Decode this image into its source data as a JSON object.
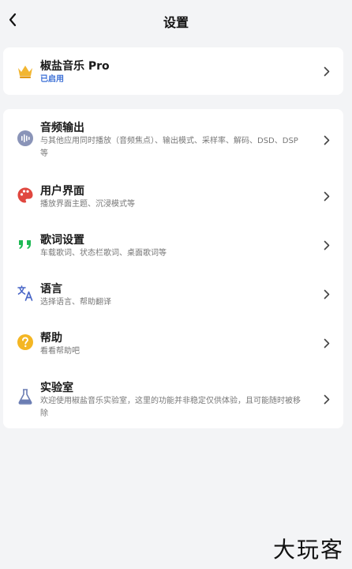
{
  "header": {
    "title": "设置"
  },
  "pro": {
    "title": "椒盐音乐 Pro",
    "status": "已启用"
  },
  "settings": [
    {
      "title": "音频输出",
      "subtitle": "与其他应用同时播放（音频焦点）、输出模式、采样率、解码、DSD、DSP 等",
      "icon": "waveform-icon"
    },
    {
      "title": "用户界面",
      "subtitle": "播放界面主题、沉浸模式等",
      "icon": "palette-icon"
    },
    {
      "title": "歌词设置",
      "subtitle": "车载歌词、状态栏歌词、桌面歌词等",
      "icon": "quote-icon"
    },
    {
      "title": "语言",
      "subtitle": "选择语言、帮助翻译",
      "icon": "translate-icon"
    },
    {
      "title": "帮助",
      "subtitle": "看看帮助吧",
      "icon": "help-icon"
    },
    {
      "title": "实验室",
      "subtitle": "欢迎使用椒盐音乐实验室，这里的功能并非稳定仅供体验，且可能随时被移除",
      "icon": "flask-icon"
    }
  ],
  "watermark": "大玩客",
  "colors": {
    "accent": "#3b6fd6",
    "crown": "#f2b632",
    "palette": "#e0473f",
    "quote": "#1db954",
    "translate": "#4a67c7",
    "help": "#f4b623",
    "flask": "#6b7db3"
  }
}
